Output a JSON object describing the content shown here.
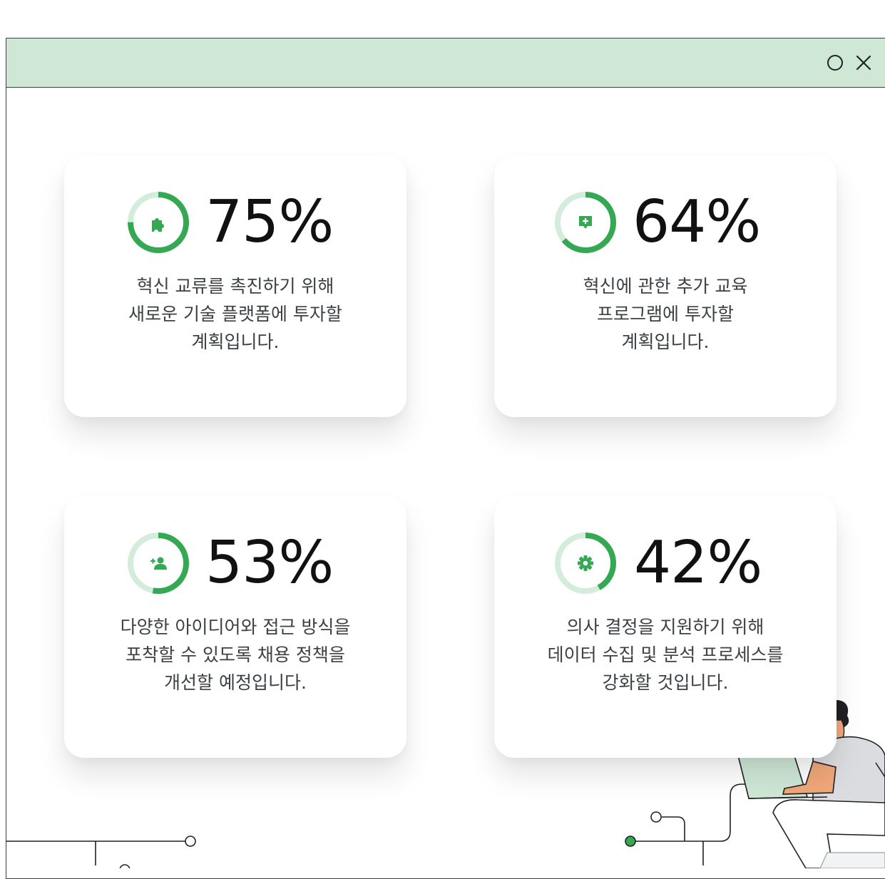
{
  "window": {
    "controls": [
      "restore-circle",
      "close-x"
    ],
    "accent_color": "#cfe8d6",
    "ring_color": "#34a853",
    "ring_track_color": "#d4ecdb"
  },
  "cards": [
    {
      "value": 75,
      "percent_label": "75%",
      "icon": "puzzle-icon",
      "lines": [
        "혁신 교류를 촉진하기 위해",
        "새로운 기술 플랫폼에 투자할",
        "계획입니다."
      ]
    },
    {
      "value": 64,
      "percent_label": "64%",
      "icon": "add-comment-icon",
      "lines": [
        "혁신에 관한 추가 교육",
        "프로그램에 투자할",
        "계획입니다."
      ]
    },
    {
      "value": 53,
      "percent_label": "53%",
      "icon": "person-add-icon",
      "lines": [
        "다양한 아이디어와 접근 방식을",
        "포착할 수 있도록 채용 정책을",
        "개선할 예정입니다."
      ]
    },
    {
      "value": 42,
      "percent_label": "42%",
      "icon": "gear-icon",
      "lines": [
        "의사 결정을 지원하기 위해",
        "데이터 수집 및 분석 프로세스를",
        "강화할 것입니다."
      ]
    }
  ]
}
